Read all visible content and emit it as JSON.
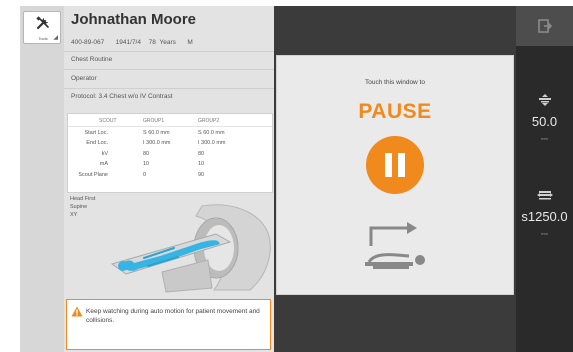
{
  "toolbar": {
    "tools_label": "Tools"
  },
  "patient": {
    "name": "Johnathan Moore",
    "id": "400-89-067",
    "dob": "1941/7/4",
    "age": "78 Years",
    "sex": "M",
    "exam": "Chest Routine",
    "operator": "Operator",
    "protocol": "Protocol: 3.4 Chest w/o IV Contrast"
  },
  "scout_table": {
    "headers": [
      "SCOUT",
      "GROUP1",
      "GROUP2"
    ],
    "rows": [
      [
        "Start Loc.",
        "S 60.0 mm",
        "S 60.0 mm"
      ],
      [
        "End Loc.",
        "I 300.0 mm",
        "I 300.0 mm"
      ],
      [
        "kV",
        "80",
        "80"
      ],
      [
        "mA",
        "10",
        "10"
      ],
      [
        "Scout Plane",
        "0",
        "90"
      ]
    ]
  },
  "position": [
    "Head First",
    "Supine",
    "XY"
  ],
  "warning": {
    "text": "Keep watching during auto motion for patient movement and collisions."
  },
  "pause_panel": {
    "touch_text": "Touch this window to",
    "title": "PAUSE"
  },
  "gauges": [
    {
      "value": "50.0",
      "unit": "mm"
    },
    {
      "value": "s1250.0",
      "unit": "mm"
    }
  ],
  "colors": {
    "accent": "#f08a1c",
    "dark": "#3b3b3b",
    "panel": "#e3e3e3"
  },
  "icons": [
    "tools-icon",
    "exit-icon",
    "warning-icon",
    "pause-icon",
    "table-motion-icon",
    "table-height-icon",
    "table-longitudinal-icon",
    "tools-caret-icon"
  ]
}
